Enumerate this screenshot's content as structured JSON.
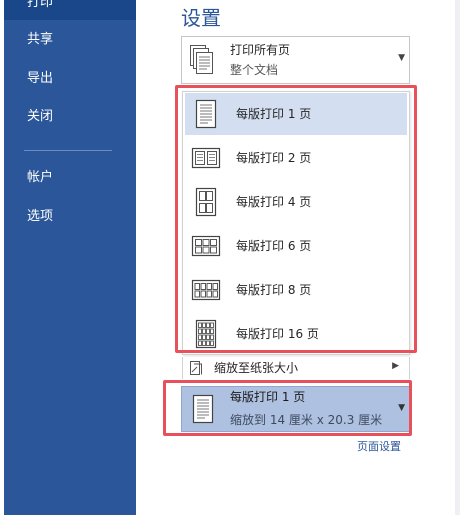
{
  "sidebar": {
    "items": [
      {
        "label": "打印",
        "active": true
      },
      {
        "label": "共享"
      },
      {
        "label": "导出"
      },
      {
        "label": "关闭"
      },
      {
        "label": "帐户"
      },
      {
        "label": "选项"
      }
    ]
  },
  "settings": {
    "title": "设置",
    "print_range": {
      "main": "打印所有页",
      "sub": "整个文档"
    },
    "pages_per_sheet": {
      "options": [
        {
          "label": "每版打印 1 页",
          "icon": "one-page-per-sheet-icon"
        },
        {
          "label": "每版打印 2 页",
          "icon": "two-pages-per-sheet-icon"
        },
        {
          "label": "每版打印 4 页",
          "icon": "four-pages-per-sheet-icon"
        },
        {
          "label": "每版打印 6 页",
          "icon": "six-pages-per-sheet-icon"
        },
        {
          "label": "每版打印 8 页",
          "icon": "eight-pages-per-sheet-icon"
        },
        {
          "label": "每版打印 16 页",
          "icon": "sixteen-pages-per-sheet-icon"
        }
      ],
      "selected_index": 0
    },
    "scale_to_paper": {
      "label": "缩放至纸张大小"
    },
    "current_selection": {
      "main": "每版打印 1 页",
      "sub": "缩放到 14 厘米 x 20.3 厘米"
    },
    "page_setup_link": "页面设置"
  },
  "colors": {
    "sidebar": "#2b579a",
    "sidebar_active": "#19478a",
    "accent": "#2b579a",
    "highlight_border": "#e8505b",
    "selected_item": "#d3dff0",
    "selected_combo": "#aec1e1"
  }
}
